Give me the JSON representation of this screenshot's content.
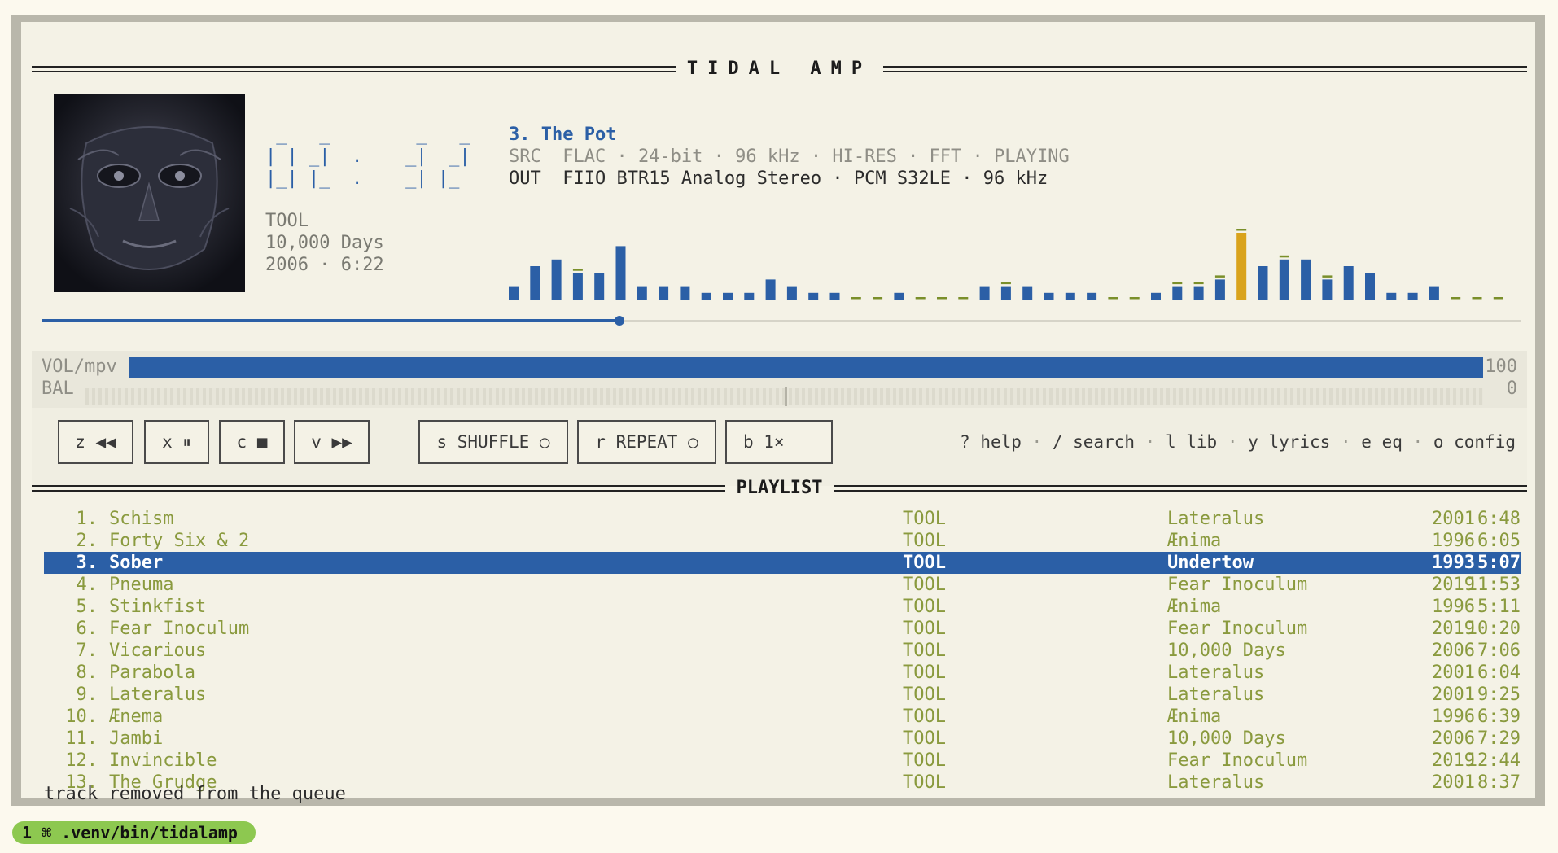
{
  "app": {
    "title": "TIDAL AMP"
  },
  "now_playing": {
    "clock": " _   _        _   _\n| | _|  .    _|  _|\n|_| |_  .    _| |_ ",
    "artist": "TOOL",
    "album": "10,000 Days",
    "year_length": "2006 · 6:22",
    "title": "3. The Pot",
    "src_line": "SRC  FLAC · 24-bit · 96 kHz · HI-RES · FFT · PLAYING",
    "out_line": "OUT  FIIO BTR15 Analog Stereo · PCM S32LE · 96 kHz",
    "cover_icon": "album-cover-face",
    "progress": 0.39
  },
  "spectrum": {
    "bars": [
      2,
      5,
      6,
      4,
      4,
      8,
      2,
      2,
      2,
      1,
      1,
      1,
      3,
      2,
      1,
      1,
      0,
      0,
      1,
      0,
      0,
      0,
      2,
      2,
      2,
      1,
      1,
      1,
      0,
      0,
      1,
      2,
      2,
      3,
      10,
      5,
      6,
      6,
      3,
      5,
      4,
      1,
      1,
      2,
      0,
      0,
      0
    ],
    "peaks": [
      0,
      0,
      0,
      1,
      0,
      0,
      0,
      0,
      0,
      0,
      0,
      0,
      0,
      0,
      0,
      0,
      1,
      1,
      0,
      1,
      1,
      1,
      0,
      1,
      0,
      0,
      0,
      0,
      1,
      1,
      0,
      1,
      1,
      1,
      1,
      0,
      1,
      0,
      1,
      0,
      0,
      0,
      0,
      0,
      1,
      1,
      1
    ],
    "highlight_index": 34,
    "colors": {
      "bar": "#2b5fa6",
      "peak": "#7a8f2a",
      "highlight": "#d9a31c"
    }
  },
  "volume": {
    "label": "VOL/mpv",
    "value": "100",
    "level": 1.0
  },
  "balance": {
    "label": "BAL",
    "value": "0",
    "level": 0.0
  },
  "controls": {
    "prev": "z ◀◀",
    "pause": "x ⏸",
    "stop": "c ■",
    "next": "v ▶▶",
    "shuffle": "s SHUFFLE ○",
    "repeat": "r REPEAT ○",
    "speed": "b 1×"
  },
  "shortcuts": {
    "help": "? help",
    "search": "/ search",
    "lib": "l lib",
    "lyrics": "y lyrics",
    "eq": "e eq",
    "config": "o config",
    "separator": "·"
  },
  "playlist": {
    "title": "PLAYLIST",
    "selected_index": 2,
    "rows": [
      {
        "num": "1.",
        "title": "Schism",
        "artist": "TOOL",
        "album": "Lateralus",
        "year": "2001",
        "dur": "6:48"
      },
      {
        "num": "2.",
        "title": "Forty Six & 2",
        "artist": "TOOL",
        "album": "Ænima",
        "year": "1996",
        "dur": "6:05"
      },
      {
        "num": "3.",
        "title": "Sober",
        "artist": "TOOL",
        "album": "Undertow",
        "year": "1993",
        "dur": "5:07"
      },
      {
        "num": "4.",
        "title": "Pneuma",
        "artist": "TOOL",
        "album": "Fear Inoculum",
        "year": "2019",
        "dur": "11:53"
      },
      {
        "num": "5.",
        "title": "Stinkfist",
        "artist": "TOOL",
        "album": "Ænima",
        "year": "1996",
        "dur": "5:11"
      },
      {
        "num": "6.",
        "title": "Fear Inoculum",
        "artist": "TOOL",
        "album": "Fear Inoculum",
        "year": "2019",
        "dur": "10:20"
      },
      {
        "num": "7.",
        "title": "Vicarious",
        "artist": "TOOL",
        "album": "10,000 Days",
        "year": "2006",
        "dur": "7:06"
      },
      {
        "num": "8.",
        "title": "Parabola",
        "artist": "TOOL",
        "album": "Lateralus",
        "year": "2001",
        "dur": "6:04"
      },
      {
        "num": "9.",
        "title": "Lateralus",
        "artist": "TOOL",
        "album": "Lateralus",
        "year": "2001",
        "dur": "9:25"
      },
      {
        "num": "10.",
        "title": "Ænema",
        "artist": "TOOL",
        "album": "Ænima",
        "year": "1996",
        "dur": "6:39"
      },
      {
        "num": "11.",
        "title": "Jambi",
        "artist": "TOOL",
        "album": "10,000 Days",
        "year": "2006",
        "dur": "7:29"
      },
      {
        "num": "12.",
        "title": "Invincible",
        "artist": "TOOL",
        "album": "Fear Inoculum",
        "year": "2019",
        "dur": "12:44"
      },
      {
        "num": "13.",
        "title": "The Grudge",
        "artist": "TOOL",
        "album": "Lateralus",
        "year": "2001",
        "dur": "8:37"
      }
    ]
  },
  "status": "track removed from the queue",
  "terminal": {
    "tab_label": "1 ⌘ .venv/bin/tidalamp"
  }
}
